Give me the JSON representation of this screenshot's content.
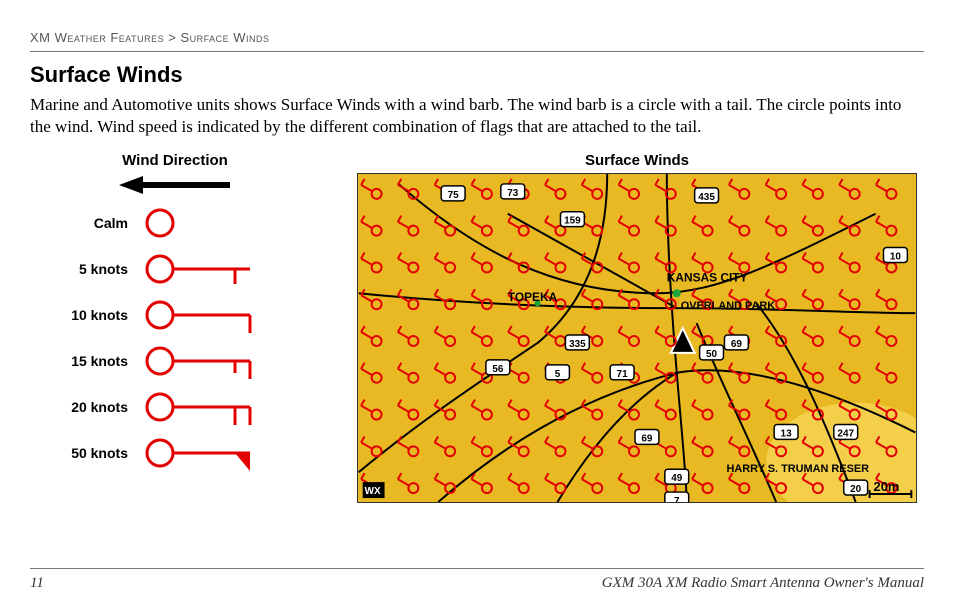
{
  "breadcrumb": {
    "section": "XM Weather Features",
    "sep": " > ",
    "page": "Surface Winds"
  },
  "section_title": "Surface Winds",
  "body_text": "Marine and Automotive units shows Surface Winds with a wind barb. The wind barb is a circle with a tail. The circle points into the wind. Wind speed is indicated by the different combination of flags that are attached to the tail.",
  "legend": {
    "title": "Wind Direction",
    "items": [
      {
        "label": "Calm"
      },
      {
        "label": "5 knots"
      },
      {
        "label": "10 knots"
      },
      {
        "label": "15 knots"
      },
      {
        "label": "20 knots"
      },
      {
        "label": "50 knots"
      }
    ]
  },
  "map": {
    "title": "Surface Winds",
    "cities": [
      {
        "name": "TOPEKA"
      },
      {
        "name": "KANSAS CITY"
      },
      {
        "name": "OVERLAND PARK"
      },
      {
        "name": "HARRY S. TRUMAN RESER"
      }
    ],
    "highways": [
      "75",
      "73",
      "159",
      "435",
      "10",
      "335",
      "56",
      "5",
      "71",
      "50",
      "69",
      "69",
      "49",
      "7",
      "13",
      "247",
      "20"
    ],
    "scale": "20m"
  },
  "footer": {
    "page_number": "11",
    "manual_title": "GXM 30A XM Radio Smart Antenna Owner's Manual"
  }
}
